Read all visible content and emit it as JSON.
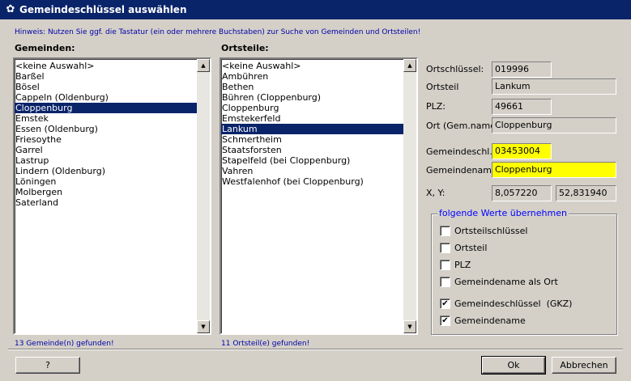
{
  "window": {
    "title": "Gemeindeschlüssel auswählen",
    "icon": "app-flower-icon"
  },
  "hint": "Hinweis: Nutzen Sie ggf. die Tastatur (ein oder mehrere Buchstaben) zur Suche von Gemeinden und Ortsteilen!",
  "gemeinden": {
    "header": "Gemeinden:",
    "items": [
      "<keine Auswahl>",
      "Barßel",
      "Bösel",
      "Cappeln (Oldenburg)",
      "Cloppenburg",
      "Emstek",
      "Essen (Oldenburg)",
      "Friesoythe",
      "Garrel",
      "Lastrup",
      "Lindern (Oldenburg)",
      "Löningen",
      "Molbergen",
      "Saterland"
    ],
    "selected": "Cloppenburg",
    "found": "13 Gemeinde(n) gefunden!"
  },
  "ortsteile": {
    "header": "Ortsteile:",
    "items": [
      "<keine Auswahl>",
      "Ambühren",
      "Bethen",
      "Bühren (Cloppenburg)",
      "Cloppenburg",
      "Emstekerfeld",
      "Lankum",
      "Schmertheim",
      "Staatsforsten",
      "Stapelfeld (bei Cloppenburg)",
      "Vahren",
      "Westfalenhof (bei Cloppenburg)"
    ],
    "selected": "Lankum",
    "found": "11 Ortsteil(e) gefunden!"
  },
  "details": {
    "ortschluessel_label": "Ortschlüssel:",
    "ortschluessel_value": "019996",
    "ortsteil_label": "Ortsteil",
    "ortsteil_value": "Lankum",
    "plz_label": "PLZ:",
    "plz_value": "49661",
    "ort_label": "Ort (Gem.name):",
    "ort_value": "Cloppenburg",
    "gemeindeschl_label": "Gemeindeschl.:",
    "gemeindeschl_value": "03453004",
    "gemeindename_label": "Gemeindename:",
    "gemeindename_value": "Cloppenburg",
    "xy_label": "X, Y:",
    "x_value": "8,057220",
    "y_value": "52,831940"
  },
  "uebernehmen": {
    "title": "folgende Werte übernehmen",
    "options": [
      {
        "label": "Ortsteilschlüssel",
        "checked": false
      },
      {
        "label": "Ortsteil",
        "checked": false
      },
      {
        "label": "PLZ",
        "checked": false
      },
      {
        "label": "Gemeindename als Ort",
        "checked": false
      },
      {
        "label": "Gemeindeschlüssel  (GKZ)",
        "checked": true
      },
      {
        "label": "Gemeindename",
        "checked": true
      }
    ]
  },
  "buttons": {
    "help": "?",
    "ok": "Ok",
    "cancel": "Abbrechen"
  },
  "colors": {
    "titlebar": "#0a246a",
    "selection": "#0a246a",
    "highlight_field": "#ffff00",
    "hint_text": "#0000a8",
    "group_title": "#0000ff"
  }
}
